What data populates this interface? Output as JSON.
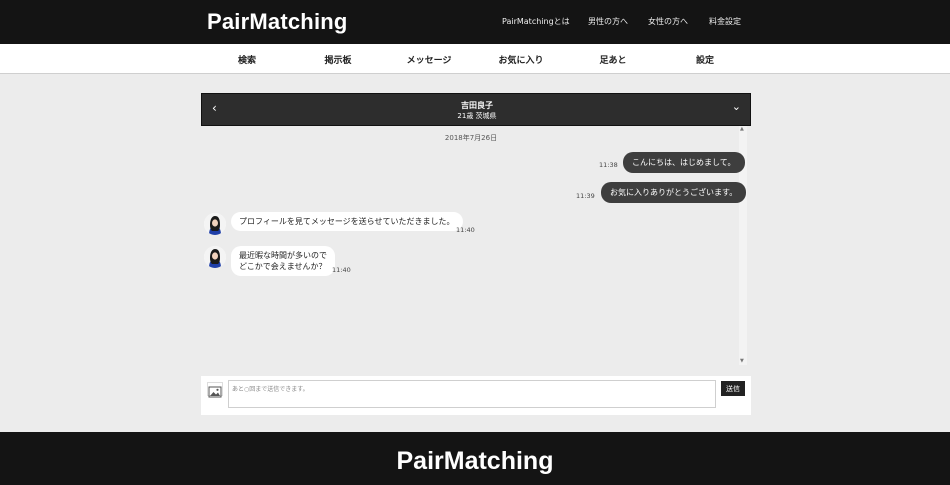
{
  "header": {
    "logo": "PairMatching",
    "nav": [
      "PairMatchingとは",
      "男性の方へ",
      "女性の方へ",
      "料金設定"
    ]
  },
  "menu": [
    "検索",
    "掲示板",
    "メッセージ",
    "お気に入り",
    "足あと",
    "設定"
  ],
  "chat": {
    "partner_name": "吉田良子",
    "partner_info": "21歳 茨城県",
    "back_icon": "‹",
    "collapse_icon": "⌄",
    "date": "2018年7月26日",
    "messages": [
      {
        "dir": "out",
        "text": "こんにちは、はじめまして。",
        "time": "11:38"
      },
      {
        "dir": "out",
        "text": "お気に入りありがとうございます。",
        "time": "11:39"
      },
      {
        "dir": "in",
        "text": "プロフィールを見てメッセージを送らせていただきました。",
        "time": "11:40"
      },
      {
        "dir": "in",
        "text_lines": [
          "最近暇な時間が多いので",
          "どこかで会えませんか？"
        ],
        "time": "11:40"
      }
    ]
  },
  "composer": {
    "placeholder": "あと○回まで送信できます。",
    "send_label": "送信",
    "image_icon": "image-icon"
  },
  "footer": {
    "logo": "PairMatching"
  }
}
